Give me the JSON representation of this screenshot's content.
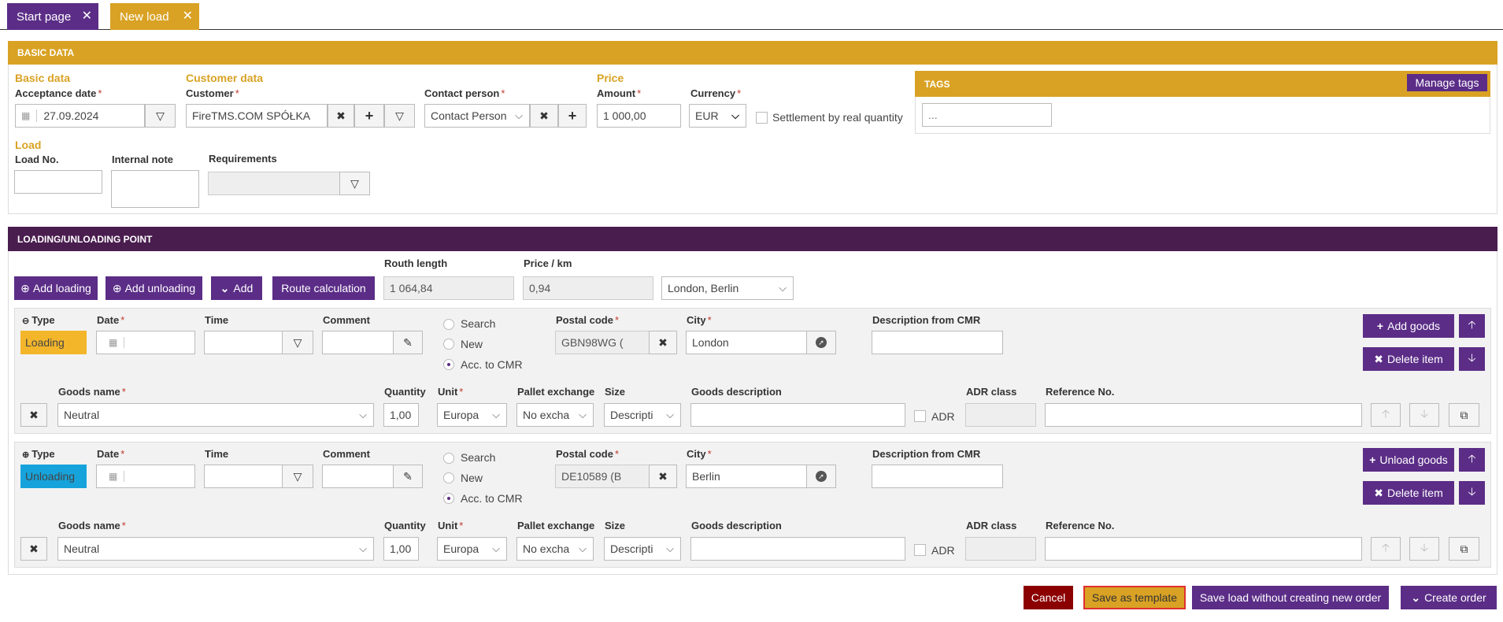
{
  "tabs": [
    {
      "label": "Start page",
      "color": "#5b2d87"
    },
    {
      "label": "New load",
      "color": "#d9a224"
    }
  ],
  "basic": {
    "bar_title": "BASIC DATA",
    "basic_data_heading": "Basic data",
    "acceptance_date_label": "Acceptance date",
    "acceptance_date": "27.09.2024",
    "customer_heading": "Customer data",
    "customer_label": "Customer",
    "customer_value": "FireTMS.COM SPÓŁKA",
    "contact_label": "Contact person",
    "contact_value": "Contact Person",
    "price_heading": "Price",
    "amount_label": "Amount",
    "amount_value": "1 000,00",
    "currency_label": "Currency",
    "currency_value": "EUR",
    "settlement_label": "Settlement by real quantity",
    "load_heading": "Load",
    "load_no_label": "Load No.",
    "internal_note_label": "Internal note",
    "requirements_label": "Requirements"
  },
  "tags": {
    "title": "TAGS",
    "manage_label": "Manage tags",
    "input_placeholder": "..."
  },
  "loading": {
    "bar_title": "LOADING/UNLOADING POINT",
    "add_loading": "Add loading",
    "add_unloading": "Add unloading",
    "add": "Add",
    "route_calc": "Route calculation",
    "route_length_label": "Routh length",
    "route_length_value": "1 064,84",
    "price_km_label": "Price / km",
    "price_km_value": "0,94",
    "route_select": "London, Berlin"
  },
  "labels": {
    "type": "Type",
    "date": "Date",
    "time": "Time",
    "comment": "Comment",
    "search": "Search",
    "new": "New",
    "acc_cmr": "Acc. to CMR",
    "postal": "Postal code",
    "city": "City",
    "desc_cmr": "Description from CMR",
    "delete_item": "Delete item",
    "goods_name": "Goods name",
    "quantity": "Quantity",
    "unit": "Unit",
    "pallet": "Pallet exchange",
    "size": "Size",
    "goods_desc": "Goods description",
    "adr_class": "ADR class",
    "adr": "ADR",
    "ref_no": "Reference No."
  },
  "points": [
    {
      "type": "Loading",
      "type_color": "#f3b62b",
      "postal": "GBN98WG (",
      "city": "London",
      "add_goods": "Add goods",
      "goods_name": "Neutral",
      "quantity": "1,00",
      "unit": "Europa",
      "pallet": "No excha",
      "size": "Descripti"
    },
    {
      "type": "Unloading",
      "type_color": "#16a3dc",
      "postal": "DE10589 (B",
      "city": "Berlin",
      "add_goods": "Unload goods",
      "goods_name": "Neutral",
      "quantity": "1,00",
      "unit": "Europa",
      "pallet": "No excha",
      "size": "Descripti"
    }
  ],
  "footer": {
    "cancel": "Cancel",
    "save_template": "Save as template",
    "save_load": "Save load without creating new order",
    "create_order": "Create order"
  },
  "colors": {
    "accent_gold": "#d9a224",
    "purple": "#5b2d87",
    "dark_purple": "#4a1d4f",
    "cancel_red": "#8b0000"
  }
}
